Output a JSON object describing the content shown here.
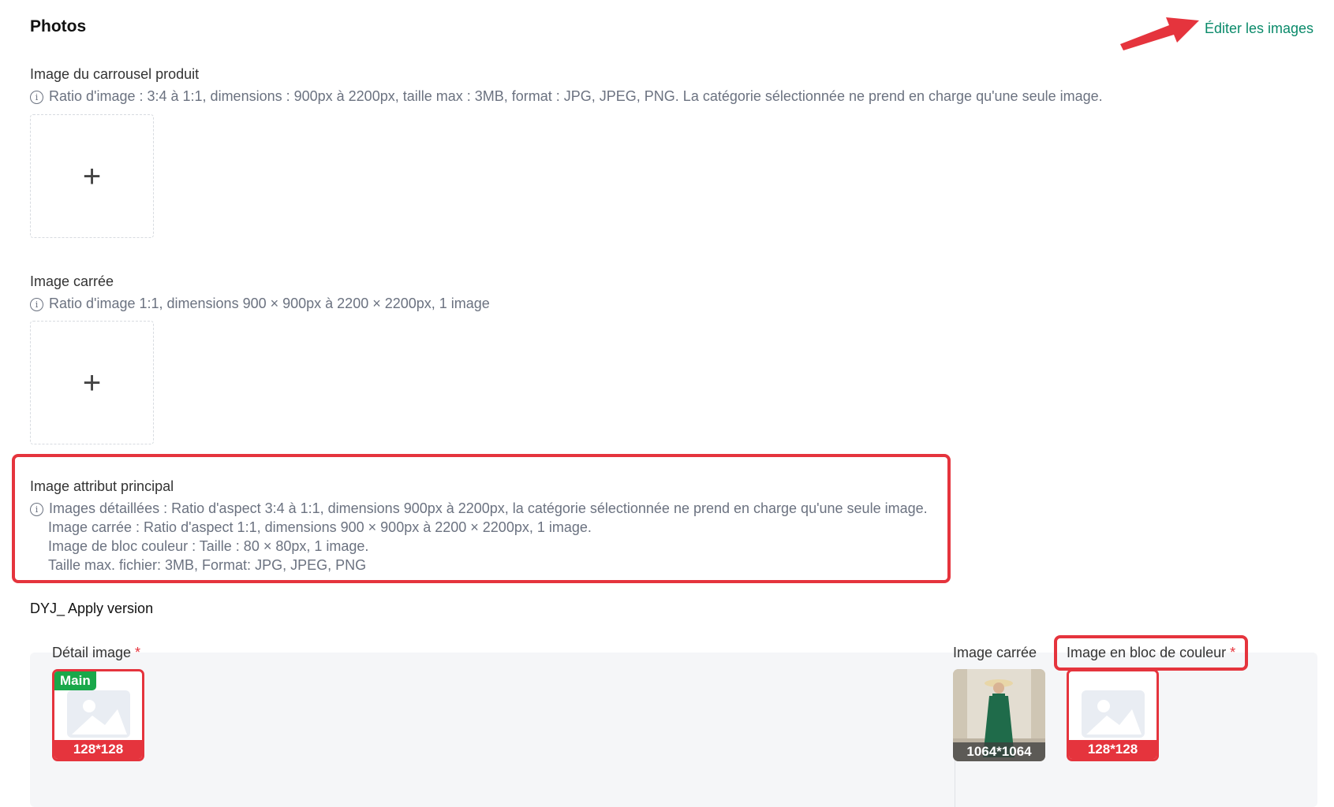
{
  "header": {
    "title": "Photos",
    "edit_link": "Éditer les images"
  },
  "carousel": {
    "label": "Image du carrousel produit",
    "hint": "Ratio d'image : 3:4 à 1:1, dimensions : 900px à 2200px, taille max : 3MB, format : JPG, JPEG, PNG. La catégorie sélectionnée ne prend en charge qu'une seule image."
  },
  "square": {
    "label": "Image carrée",
    "hint": "Ratio d'image 1:1, dimensions 900 × 900px à 2200 × 2200px, 1 image"
  },
  "attribute": {
    "label": "Image attribut principal",
    "hint_lines": [
      "Images détaillées : Ratio d'aspect 3:4 à 1:1, dimensions 900px à 2200px, la catégorie sélectionnée ne prend en charge qu'une seule image.",
      "Image carrée : Ratio d'aspect 1:1, dimensions 900 × 900px à 2200 × 2200px, 1 image.",
      "Image de bloc couleur : Taille : 80 × 80px, 1 image.",
      "Taille max. fichier: 3MB, Format: JPG, JPEG, PNG"
    ]
  },
  "variant": {
    "name": "DYJ_ Apply version",
    "detail_label": "Détail image",
    "detail_badge": "Main",
    "detail_size": "128*128",
    "square_label": "Image carrée",
    "square_size": "1064*1064",
    "color_label": "Image en bloc de couleur",
    "color_size": "128*128",
    "required_mark": "*"
  },
  "colors": {
    "accent_green": "#0a8a6a",
    "highlight_red": "#e5343d",
    "badge_green": "#19a84a"
  }
}
